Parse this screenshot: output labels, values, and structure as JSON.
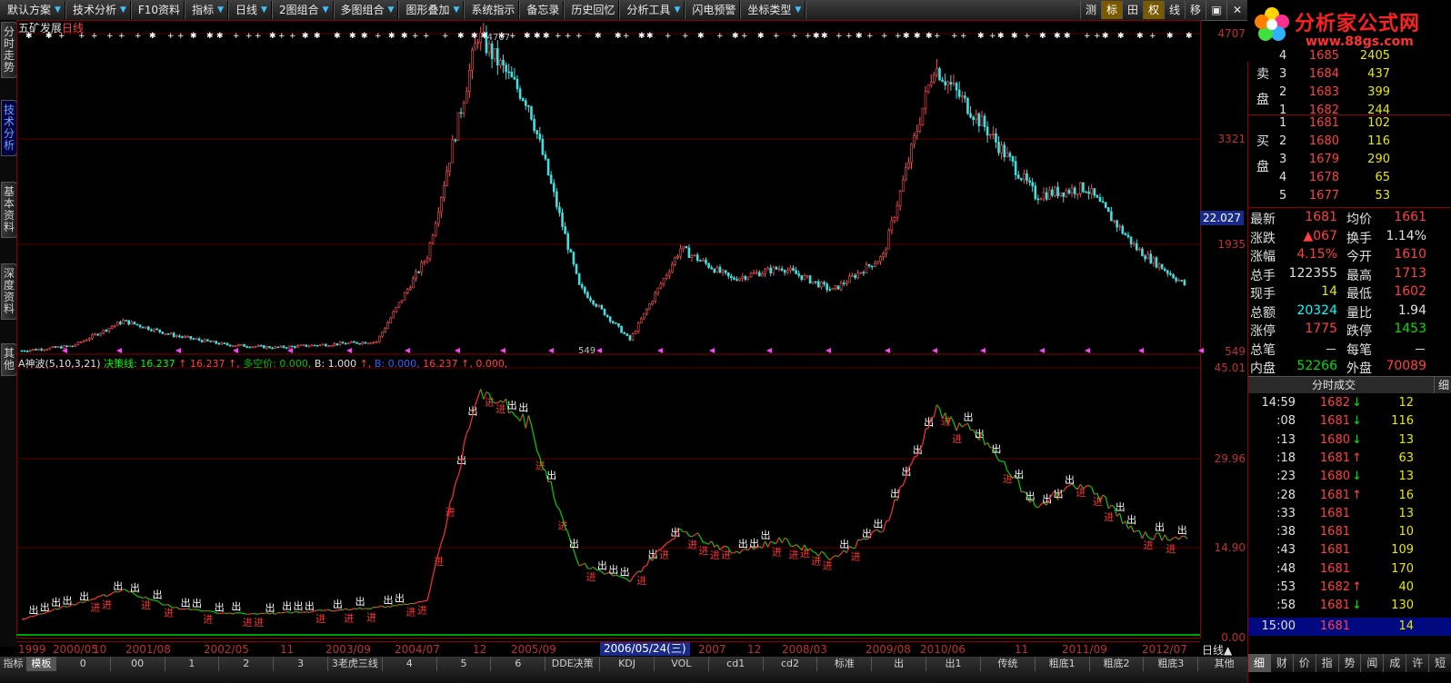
{
  "menu": {
    "items": [
      {
        "label": "默认方案",
        "drop": true
      },
      {
        "label": "技术分析",
        "drop": true
      },
      {
        "label": "F10资料",
        "drop": false
      },
      {
        "label": "指标",
        "drop": true
      },
      {
        "label": "日线",
        "drop": true
      },
      {
        "label": "2图组合",
        "drop": true
      },
      {
        "label": "多图组合",
        "drop": true
      },
      {
        "label": "图形叠加",
        "drop": true
      },
      {
        "label": "系统指示",
        "drop": false
      },
      {
        "label": "备忘录",
        "drop": false
      },
      {
        "label": "历史回忆",
        "drop": false
      },
      {
        "label": "分析工具",
        "drop": true
      },
      {
        "label": "闪电预警",
        "drop": false
      },
      {
        "label": "坐标类型",
        "drop": true
      }
    ],
    "tools": [
      {
        "label": "测",
        "active": false
      },
      {
        "label": "标",
        "active": true
      },
      {
        "label": "田",
        "active": false
      },
      {
        "label": "权",
        "active": true
      },
      {
        "label": "线",
        "active": false
      },
      {
        "label": "移",
        "active": false
      },
      {
        "label": "▣",
        "active": false
      },
      {
        "label": "✕",
        "active": false
      }
    ]
  },
  "logo": {
    "title": "分析家公式网",
    "url": "www.88gs.com"
  },
  "left_tabs": [
    {
      "label": "分时走势",
      "active": false
    },
    {
      "label": "技术分析",
      "active": true
    },
    {
      "label": "基本资料",
      "active": false
    },
    {
      "label": "深度资料",
      "active": false
    },
    {
      "label": "其他",
      "active": false
    }
  ],
  "chart": {
    "stock_name": "五矿发展",
    "period": "日线",
    "main_y_labels": [
      "4707",
      "3321",
      "1935",
      "549"
    ],
    "max_label": "4707",
    "min_label": "549",
    "price_badge": "22.027",
    "ind_y_labels": [
      "45.01",
      "29.96",
      "14.90",
      "0.00"
    ],
    "indicator": {
      "name": "A神波(5,10,3,21)",
      "parts": [
        {
          "text": "决策线: 16.237",
          "color": "#00ff00"
        },
        {
          "text": "↑",
          "color": "#ff4040"
        },
        {
          "text": "16.237",
          "color": "#ff4040"
        },
        {
          "text": "↑,",
          "color": "#ff4040"
        },
        {
          "text": "多空价: 0.000,",
          "color": "#00c000"
        },
        {
          "text": "B: 1.000",
          "color": "#e0e0e0"
        },
        {
          "text": "↑,",
          "color": "#ff4040"
        },
        {
          "text": "B: 0.000,",
          "color": "#3060ff"
        },
        {
          "text": "16.237",
          "color": "#ff4040"
        },
        {
          "text": "↑,",
          "color": "#ff4040"
        },
        {
          "text": "0.000,",
          "color": "#ff4040"
        }
      ]
    },
    "in_label": "进",
    "out_label": "出"
  },
  "chart_data": {
    "type": "line",
    "title": "五矿发展 日线",
    "ylim": [
      549,
      4707
    ],
    "x": [
      "1999",
      "2000/05",
      "2001/08",
      "2002/05",
      "2003/09",
      "2004/07",
      "2005/09",
      "2006/05/24",
      "2007",
      "2008/03",
      "2009/08",
      "2010/06",
      "2011/09",
      "2012/07"
    ],
    "series": [
      {
        "name": "价格",
        "values": [
          560,
          620,
          950,
          760,
          640,
          600,
          640,
          680,
          1800,
          4707,
          3800,
          1400,
          700,
          1900,
          1500,
          1650,
          1350,
          1800,
          4300,
          3500,
          2600,
          2700,
          1900,
          1400
        ]
      },
      {
        "name": "决策线",
        "values": [
          2.5,
          5.0,
          7.5,
          4.5,
          3.5,
          3.5,
          4.0,
          4.5,
          5.5,
          42.0,
          36.0,
          12.0,
          9.0,
          18.0,
          14.0,
          16.0,
          13.0,
          18.0,
          38.0,
          33.0,
          22.0,
          26.0,
          17.0,
          16.2
        ]
      }
    ],
    "indicator_ylim": [
      0,
      45.01
    ]
  },
  "date_axis": {
    "labels": [
      "1999",
      "2000/05",
      "10",
      "2001/08",
      "2002/05",
      "11",
      "2003/09",
      "2004/07",
      "12",
      "2005/09",
      "2007",
      "12",
      "2008/03",
      "2009/08",
      "2010/06",
      "11",
      "2011/09",
      "2012/07"
    ],
    "cursor_date": "2006/05/24(三)",
    "period_label": "日线▲"
  },
  "bottom_tabs": [
    {
      "label": "指标",
      "active": false
    },
    {
      "label": "模板",
      "active": true
    },
    {
      "label": "0",
      "active": false
    },
    {
      "label": "00",
      "active": false
    },
    {
      "label": "1",
      "active": false
    },
    {
      "label": "2",
      "active": false
    },
    {
      "label": "3",
      "active": false
    },
    {
      "label": "3老虎三线",
      "active": false
    },
    {
      "label": "4",
      "active": false
    },
    {
      "label": "5",
      "active": false
    },
    {
      "label": "6",
      "active": false
    },
    {
      "label": "DDE决策",
      "active": false
    },
    {
      "label": "KDJ",
      "active": false
    },
    {
      "label": "VOL",
      "active": false
    },
    {
      "label": "cd1",
      "active": false
    },
    {
      "label": "cd2",
      "active": false
    },
    {
      "label": "标准",
      "active": false
    },
    {
      "label": "出",
      "active": false
    },
    {
      "label": "出1",
      "active": false
    },
    {
      "label": "传统",
      "active": false
    },
    {
      "label": "粗底1",
      "active": false
    },
    {
      "label": "粗底2",
      "active": false
    },
    {
      "label": "粗底3",
      "active": false
    },
    {
      "label": "其他",
      "active": false
    }
  ],
  "orderbook": {
    "sell": [
      {
        "lvl": "4",
        "price": "1685",
        "vol": "2405"
      },
      {
        "lvl": "3",
        "price": "1684",
        "vol": "437"
      },
      {
        "lvl": "2",
        "price": "1683",
        "vol": "399"
      },
      {
        "lvl": "1",
        "price": "1682",
        "vol": "244"
      }
    ],
    "buy": [
      {
        "lvl": "1",
        "price": "1681",
        "vol": "102"
      },
      {
        "lvl": "2",
        "price": "1680",
        "vol": "116"
      },
      {
        "lvl": "3",
        "price": "1679",
        "vol": "290"
      },
      {
        "lvl": "4",
        "price": "1678",
        "vol": "65"
      },
      {
        "lvl": "5",
        "price": "1677",
        "vol": "53"
      }
    ],
    "sell_label": "卖盘",
    "buy_label": "买盘"
  },
  "quote": [
    {
      "k": "最新",
      "v": "1681",
      "vc": "red",
      "k2": "均价",
      "v2": "1661",
      "v2c": "red"
    },
    {
      "k": "涨跌",
      "v": "▲067",
      "vc": "red",
      "k2": "换手",
      "v2": "1.14%",
      "v2c": "wht"
    },
    {
      "k": "涨幅",
      "v": "4.15%",
      "vc": "red",
      "k2": "今开",
      "v2": "1610",
      "v2c": "red"
    },
    {
      "k": "总手",
      "v": "122355",
      "vc": "wht",
      "k2": "最高",
      "v2": "1713",
      "v2c": "red"
    },
    {
      "k": "现手",
      "v": "14",
      "vc": "yel",
      "k2": "最低",
      "v2": "1602",
      "v2c": "red"
    },
    {
      "k": "总额",
      "v": "20324",
      "vc": "cy",
      "k2": "量比",
      "v2": "1.94",
      "v2c": "wht"
    },
    {
      "k": "涨停",
      "v": "1775",
      "vc": "red",
      "k2": "跌停",
      "v2": "1453",
      "v2c": "green"
    },
    {
      "k": "总笔",
      "v": "－",
      "vc": "wht",
      "k2": "每笔",
      "v2": "－",
      "v2c": "wht"
    },
    {
      "k": "内盘",
      "v": "52266",
      "vc": "green",
      "k2": "外盘",
      "v2": "70089",
      "v2c": "red"
    }
  ],
  "ticks": {
    "header": "分时成交",
    "detail_label": "细",
    "rows": [
      {
        "t": "14:59",
        "p": "1682",
        "dir": "down",
        "v": "12"
      },
      {
        "t": ":08",
        "p": "1681",
        "dir": "down",
        "v": "116"
      },
      {
        "t": ":13",
        "p": "1680",
        "dir": "down",
        "v": "13"
      },
      {
        "t": ":18",
        "p": "1681",
        "dir": "up",
        "v": "63"
      },
      {
        "t": ":23",
        "p": "1680",
        "dir": "down",
        "v": "13"
      },
      {
        "t": ":28",
        "p": "1681",
        "dir": "up",
        "v": "16"
      },
      {
        "t": ":33",
        "p": "1681",
        "dir": "none",
        "v": "13"
      },
      {
        "t": ":38",
        "p": "1681",
        "dir": "none",
        "v": "10"
      },
      {
        "t": ":43",
        "p": "1681",
        "dir": "none",
        "v": "109"
      },
      {
        "t": ":48",
        "p": "1681",
        "dir": "none",
        "v": "170"
      },
      {
        "t": ":53",
        "p": "1682",
        "dir": "up",
        "v": "40"
      },
      {
        "t": ":58",
        "p": "1681",
        "dir": "down",
        "v": "130"
      }
    ],
    "last": {
      "t": "15:00",
      "p": "1681",
      "v": "14"
    }
  },
  "right_tabs": [
    {
      "label": "细",
      "active": true
    },
    {
      "label": "财",
      "active": false
    },
    {
      "label": "价",
      "active": false
    },
    {
      "label": "指",
      "active": false
    },
    {
      "label": "势",
      "active": false
    },
    {
      "label": "闻",
      "active": false
    },
    {
      "label": "成",
      "active": false
    },
    {
      "label": "许",
      "active": false
    },
    {
      "label": "短",
      "active": false
    }
  ]
}
